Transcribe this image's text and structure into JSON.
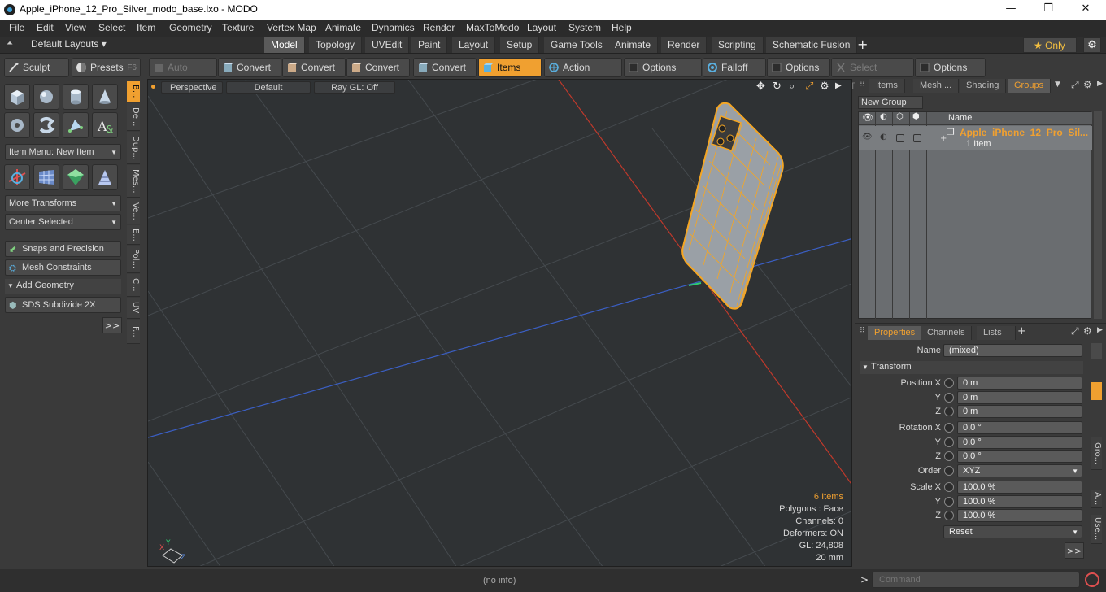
{
  "window": {
    "title": "Apple_iPhone_12_Pro_Silver_modo_base.lxo - MODO",
    "minimize": "—",
    "maximize": "❐",
    "close": "✕"
  },
  "menu": [
    "File",
    "Edit",
    "View",
    "Select",
    "Item",
    "Geometry",
    "Texture",
    "Vertex Map",
    "Animate",
    "Dynamics",
    "Render",
    "MaxToModo",
    "Layout",
    "System",
    "Help"
  ],
  "layouts": {
    "default_label": "Default Layouts ▾",
    "tabs": [
      "Model",
      "Topology",
      "UVEdit",
      "Paint",
      "Layout",
      "Setup",
      "Game Tools",
      "Animate",
      "Render",
      "Scripting",
      "Schematic Fusion"
    ],
    "active_tab": "Model",
    "add": "+",
    "only_label": "★  Only"
  },
  "toolbar": {
    "sculpt": "Sculpt",
    "presets": "Presets",
    "presets_key": "F6",
    "auto_select": "Auto Select",
    "convert1": "Convert",
    "convert2": "Convert",
    "convert3": "Convert",
    "convert4": "Convert",
    "items": "Items",
    "action_center": "Action Center",
    "options1": "Options",
    "falloff": "Falloff",
    "options2": "Options",
    "select_through": "Select Through",
    "options3": "Options"
  },
  "leftpanel": {
    "item_menu": "Item Menu: New Item",
    "more_transforms": "More Transforms",
    "center_selected": "Center Selected",
    "snaps": "Snaps and Precision",
    "mesh_constraints": "Mesh Constraints",
    "add_geometry": "Add Geometry",
    "sds_subdivide": "SDS Subdivide 2X",
    "more": ">>",
    "vtabs": [
      "B...",
      "De...",
      "Dup...",
      "Mes...",
      "Ve...",
      "E...",
      "Pol...",
      "C...",
      "UV",
      "F..."
    ]
  },
  "viewport": {
    "perspective": "Perspective",
    "default": "Default",
    "raygl": "Ray GL: Off",
    "stats": {
      "items": "6 Items",
      "polygons": "Polygons : Face",
      "channels": "Channels: 0",
      "deformers": "Deformers: ON",
      "gl": "GL: 24,808",
      "size": "20 mm"
    }
  },
  "groups_panel": {
    "tabs": [
      "Items",
      "Mesh ...",
      "Shading",
      "Groups"
    ],
    "active_tab": "Groups",
    "new_group": "New Group",
    "name_header": "Name",
    "row_name": "Apple_iPhone_12_Pro_Sil...",
    "row_sub": "1 Item"
  },
  "properties_panel": {
    "tabs": [
      "Properties",
      "Channels",
      "Lists"
    ],
    "active_tab": "Properties",
    "add": "+",
    "name_label": "Name",
    "name_value": "(mixed)",
    "transform": "Transform",
    "position_x_label": "Position X",
    "y": "Y",
    "z": "Z",
    "position": [
      "0 m",
      "0 m",
      "0 m"
    ],
    "rotation_x_label": "Rotation X",
    "rotation": [
      "0.0 °",
      "0.0 °",
      "0.0 °"
    ],
    "order_label": "Order",
    "order_value": "XYZ",
    "scale_x_label": "Scale X",
    "scale": [
      "100.0 %",
      "100.0 %",
      "100.0 %"
    ],
    "reset": "Reset",
    "more": ">>",
    "vtabs": [
      "Gro...",
      "A...",
      "Use..."
    ]
  },
  "status": {
    "info": "(no info)",
    "prompt": ">",
    "command_placeholder": "Command"
  },
  "colors": {
    "accent": "#f0a030",
    "viewport_bg": "#2f3234",
    "x_axis": "#c0392b",
    "z_axis": "#3b5fc4",
    "mesh": "#f5a623"
  }
}
